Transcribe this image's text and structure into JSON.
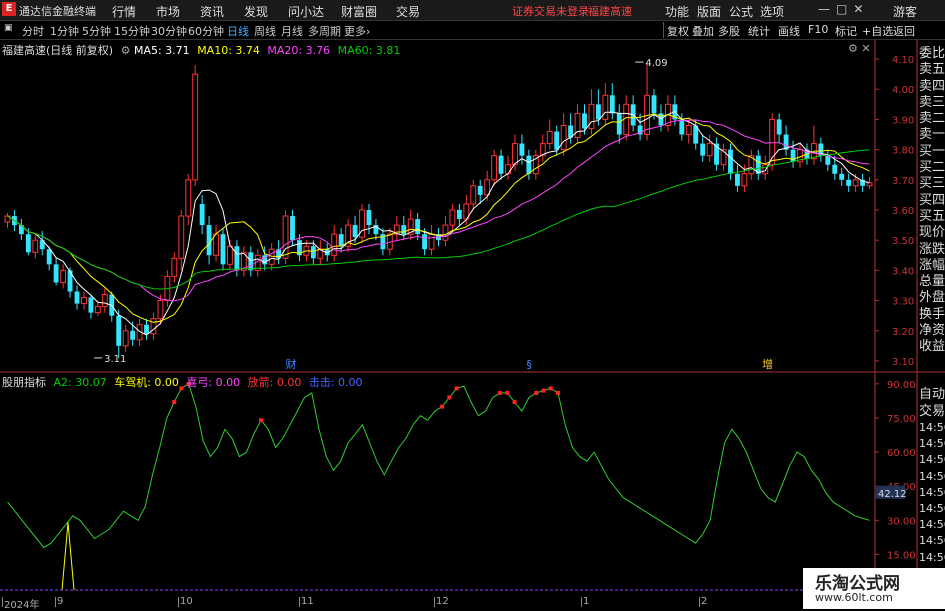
{
  "menubar": {
    "logo": "E",
    "app_title": "通达信金融终端",
    "menus": [
      "行情",
      "市场",
      "资讯",
      "发现",
      "问小达",
      "财富圈",
      "交易"
    ],
    "notice": "证券交易未登录",
    "stock_name": "福建高速",
    "right_menus": [
      "功能",
      "版面",
      "公式",
      "选项"
    ],
    "window_controls": "—□✕",
    "guest": "游客"
  },
  "toolbar": {
    "periods": [
      "分时",
      "1分钟",
      "5分钟",
      "15分钟",
      "30分钟",
      "60分钟",
      "日线",
      "周线",
      "月线",
      "多周期",
      "更多"
    ],
    "active": "日线",
    "right": [
      "复权",
      "叠加",
      "多股",
      "统计",
      "画线",
      "F10",
      "标记",
      "+自选",
      "返回"
    ]
  },
  "main_legend": {
    "title": "福建高速(日线 前复权)",
    "ma5": "MA5: 3.71",
    "ma10": "MA10: 3.74",
    "ma20": "MA20: 3.76",
    "ma60": "MA60: 3.81",
    "colors": {
      "ma5": "#ffffff",
      "ma10": "#ffff00",
      "ma20": "#ff44ff",
      "ma60": "#00cc00"
    }
  },
  "sub_legend": {
    "title": "股朋指标",
    "a2": "A2: 30.07",
    "a2_color": "#00cc00",
    "items": [
      {
        "label": "车驾机: 0.00",
        "color": "#ffff00"
      },
      {
        "label": "喜弓: 0.00",
        "color": "#ff44ff"
      },
      {
        "label": "放箭: 0.00",
        "color": "#ff3333"
      },
      {
        "label": "击击: 0.00",
        "color": "#3333ff"
      }
    ]
  },
  "chart_data": [
    {
      "type": "candlestick",
      "y_ticks": [
        "4.10",
        "4.00",
        "3.90",
        "3.80",
        "3.70",
        "3.60",
        "3.50",
        "3.40",
        "3.30",
        "3.20",
        "3.10"
      ],
      "ylim": [
        3.07,
        4.13
      ],
      "annotations": [
        {
          "text": "3.11",
          "x": 0.117,
          "y": 3.11
        },
        {
          "text": "4.09",
          "x": 0.737,
          "y": 4.09
        },
        {
          "text": "财",
          "x": 0.327,
          "y": 3.09
        },
        {
          "text": "§",
          "x": 0.603,
          "y": 3.09
        },
        {
          "text": "增",
          "x": 0.873,
          "y": 3.09
        }
      ],
      "candles": [
        [
          3.56,
          3.58,
          3.59,
          3.54
        ],
        [
          3.58,
          3.55,
          3.6,
          3.53
        ],
        [
          3.55,
          3.52,
          3.57,
          3.5
        ],
        [
          3.52,
          3.46,
          3.54,
          3.45
        ],
        [
          3.46,
          3.5,
          3.52,
          3.44
        ],
        [
          3.5,
          3.47,
          3.53,
          3.45
        ],
        [
          3.47,
          3.42,
          3.48,
          3.4
        ],
        [
          3.42,
          3.36,
          3.44,
          3.35
        ],
        [
          3.36,
          3.4,
          3.42,
          3.34
        ],
        [
          3.4,
          3.33,
          3.41,
          3.31
        ],
        [
          3.33,
          3.29,
          3.35,
          3.27
        ],
        [
          3.29,
          3.31,
          3.33,
          3.27
        ],
        [
          3.31,
          3.26,
          3.32,
          3.24
        ],
        [
          3.26,
          3.28,
          3.3,
          3.25
        ],
        [
          3.28,
          3.32,
          3.34,
          3.26
        ],
        [
          3.32,
          3.25,
          3.33,
          3.23
        ],
        [
          3.25,
          3.15,
          3.27,
          3.11
        ],
        [
          3.15,
          3.2,
          3.22,
          3.13
        ],
        [
          3.2,
          3.17,
          3.23,
          3.15
        ],
        [
          3.17,
          3.22,
          3.24,
          3.15
        ],
        [
          3.22,
          3.19,
          3.24,
          3.17
        ],
        [
          3.19,
          3.24,
          3.26,
          3.17
        ],
        [
          3.24,
          3.3,
          3.32,
          3.22
        ],
        [
          3.3,
          3.38,
          3.4,
          3.28
        ],
        [
          3.38,
          3.44,
          3.46,
          3.36
        ],
        [
          3.44,
          3.58,
          3.6,
          3.4
        ],
        [
          3.58,
          3.7,
          3.72,
          3.55
        ],
        [
          3.7,
          4.05,
          4.08,
          3.68
        ],
        [
          3.62,
          3.55,
          3.65,
          3.52
        ],
        [
          3.55,
          3.45,
          3.58,
          3.42
        ],
        [
          3.45,
          3.52,
          3.55,
          3.43
        ],
        [
          3.52,
          3.42,
          3.54,
          3.4
        ],
        [
          3.42,
          3.48,
          3.5,
          3.4
        ],
        [
          3.48,
          3.4,
          3.5,
          3.38
        ],
        [
          3.4,
          3.46,
          3.48,
          3.38
        ],
        [
          3.46,
          3.4,
          3.48,
          3.38
        ],
        [
          3.4,
          3.45,
          3.47,
          3.38
        ],
        [
          3.45,
          3.42,
          3.48,
          3.4
        ],
        [
          3.42,
          3.47,
          3.49,
          3.4
        ],
        [
          3.47,
          3.44,
          3.5,
          3.42
        ],
        [
          3.44,
          3.58,
          3.6,
          3.42
        ],
        [
          3.58,
          3.5,
          3.6,
          3.48
        ],
        [
          3.5,
          3.45,
          3.52,
          3.43
        ],
        [
          3.45,
          3.48,
          3.5,
          3.43
        ],
        [
          3.48,
          3.44,
          3.5,
          3.42
        ],
        [
          3.44,
          3.47,
          3.5,
          3.42
        ],
        [
          3.47,
          3.45,
          3.49,
          3.43
        ],
        [
          3.45,
          3.52,
          3.55,
          3.43
        ],
        [
          3.52,
          3.48,
          3.54,
          3.46
        ],
        [
          3.48,
          3.55,
          3.57,
          3.46
        ],
        [
          3.55,
          3.51,
          3.58,
          3.49
        ],
        [
          3.51,
          3.6,
          3.62,
          3.49
        ],
        [
          3.6,
          3.55,
          3.62,
          3.52
        ],
        [
          3.55,
          3.52,
          3.57,
          3.5
        ],
        [
          3.52,
          3.47,
          3.54,
          3.45
        ],
        [
          3.47,
          3.52,
          3.54,
          3.45
        ],
        [
          3.52,
          3.55,
          3.58,
          3.5
        ],
        [
          3.55,
          3.52,
          3.58,
          3.5
        ],
        [
          3.52,
          3.57,
          3.6,
          3.5
        ],
        [
          3.57,
          3.52,
          3.59,
          3.5
        ],
        [
          3.52,
          3.47,
          3.54,
          3.45
        ],
        [
          3.47,
          3.52,
          3.55,
          3.45
        ],
        [
          3.52,
          3.5,
          3.54,
          3.48
        ],
        [
          3.5,
          3.55,
          3.58,
          3.48
        ],
        [
          3.55,
          3.6,
          3.62,
          3.53
        ],
        [
          3.6,
          3.57,
          3.62,
          3.55
        ],
        [
          3.57,
          3.62,
          3.65,
          3.55
        ],
        [
          3.62,
          3.68,
          3.7,
          3.6
        ],
        [
          3.68,
          3.65,
          3.7,
          3.62
        ],
        [
          3.65,
          3.7,
          3.73,
          3.63
        ],
        [
          3.7,
          3.78,
          3.8,
          3.68
        ],
        [
          3.78,
          3.72,
          3.8,
          3.7
        ],
        [
          3.72,
          3.75,
          3.78,
          3.7
        ],
        [
          3.75,
          3.82,
          3.85,
          3.73
        ],
        [
          3.82,
          3.78,
          3.85,
          3.75
        ],
        [
          3.78,
          3.72,
          3.8,
          3.7
        ],
        [
          3.72,
          3.78,
          3.8,
          3.7
        ],
        [
          3.78,
          3.82,
          3.85,
          3.76
        ],
        [
          3.82,
          3.86,
          3.9,
          3.8
        ],
        [
          3.86,
          3.8,
          3.88,
          3.78
        ],
        [
          3.8,
          3.88,
          3.92,
          3.78
        ],
        [
          3.88,
          3.84,
          3.92,
          3.82
        ],
        [
          3.84,
          3.92,
          3.95,
          3.82
        ],
        [
          3.92,
          3.87,
          3.95,
          3.85
        ],
        [
          3.87,
          3.95,
          4.0,
          3.85
        ],
        [
          3.95,
          3.9,
          4.0,
          3.88
        ],
        [
          3.9,
          3.98,
          4.02,
          3.88
        ],
        [
          3.98,
          3.92,
          4.02,
          3.9
        ],
        [
          3.92,
          3.85,
          3.95,
          3.82
        ],
        [
          3.85,
          3.95,
          3.98,
          3.83
        ],
        [
          3.95,
          3.88,
          3.98,
          3.86
        ],
        [
          3.88,
          3.85,
          3.92,
          3.83
        ],
        [
          3.85,
          3.98,
          4.09,
          3.83
        ],
        [
          3.98,
          3.92,
          4.0,
          3.9
        ],
        [
          3.92,
          3.88,
          3.95,
          3.86
        ],
        [
          3.88,
          3.95,
          3.98,
          3.86
        ],
        [
          3.95,
          3.9,
          3.98,
          3.88
        ],
        [
          3.9,
          3.85,
          3.92,
          3.83
        ],
        [
          3.85,
          3.88,
          3.9,
          3.82
        ],
        [
          3.88,
          3.82,
          3.9,
          3.8
        ],
        [
          3.82,
          3.78,
          3.85,
          3.76
        ],
        [
          3.78,
          3.82,
          3.85,
          3.76
        ],
        [
          3.82,
          3.75,
          3.84,
          3.73
        ],
        [
          3.75,
          3.8,
          3.82,
          3.73
        ],
        [
          3.8,
          3.72,
          3.82,
          3.7
        ],
        [
          3.72,
          3.68,
          3.75,
          3.66
        ],
        [
          3.68,
          3.72,
          3.75,
          3.66
        ],
        [
          3.72,
          3.78,
          3.8,
          3.7
        ],
        [
          3.78,
          3.72,
          3.8,
          3.7
        ],
        [
          3.72,
          3.75,
          3.78,
          3.7
        ],
        [
          3.75,
          3.9,
          3.92,
          3.73
        ],
        [
          3.9,
          3.85,
          3.92,
          3.82
        ],
        [
          3.85,
          3.8,
          3.88,
          3.78
        ],
        [
          3.8,
          3.76,
          3.83,
          3.74
        ],
        [
          3.76,
          3.8,
          3.82,
          3.74
        ],
        [
          3.8,
          3.77,
          3.82,
          3.75
        ],
        [
          3.77,
          3.82,
          3.88,
          3.75
        ],
        [
          3.82,
          3.78,
          3.84,
          3.76
        ],
        [
          3.78,
          3.75,
          3.8,
          3.73
        ],
        [
          3.75,
          3.72,
          3.78,
          3.7
        ],
        [
          3.72,
          3.7,
          3.74,
          3.68
        ],
        [
          3.7,
          3.68,
          3.72,
          3.66
        ],
        [
          3.68,
          3.7,
          3.72,
          3.66
        ],
        [
          3.7,
          3.68,
          3.72,
          3.66
        ],
        [
          3.68,
          3.69,
          3.71,
          3.67
        ]
      ]
    },
    {
      "type": "line",
      "y_ticks": [
        "90.00",
        "75.00",
        "60.00",
        "45.00",
        "30.00",
        "15.00"
      ],
      "ylim": [
        13,
        93
      ],
      "current_value_tag": "42.12",
      "series": [
        {
          "name": "A2",
          "values": [
            38,
            34,
            30,
            26,
            22,
            18,
            20,
            24,
            28,
            32,
            30,
            26,
            22,
            24,
            26,
            30,
            34,
            32,
            30,
            36,
            50,
            62,
            75,
            82,
            88,
            90,
            80,
            65,
            58,
            62,
            70,
            66,
            58,
            60,
            68,
            74,
            70,
            62,
            66,
            72,
            78,
            84,
            86,
            70,
            58,
            52,
            56,
            64,
            68,
            72,
            64,
            56,
            50,
            56,
            62,
            66,
            72,
            76,
            74,
            78,
            80,
            84,
            88,
            89,
            82,
            76,
            78,
            84,
            86,
            86,
            82,
            78,
            84,
            86,
            87,
            88,
            86,
            72,
            62,
            58,
            56,
            60,
            54,
            48,
            44,
            40,
            38,
            36,
            34,
            32,
            30,
            28,
            26,
            24,
            22,
            20,
            24,
            30,
            48,
            64,
            70,
            66,
            60,
            52,
            44,
            40,
            38,
            46,
            54,
            60,
            58,
            52,
            48,
            42,
            38,
            36,
            34,
            32,
            31,
            30
          ]
        }
      ],
      "signal_points_indices": [
        23,
        24,
        25,
        35,
        60,
        61,
        62,
        68,
        69,
        70,
        73,
        74,
        75,
        76
      ]
    }
  ],
  "x_labels": [
    {
      "text": "2024年",
      "x": 4
    },
    {
      "text": "9",
      "x": 57
    },
    {
      "text": "10",
      "x": 180
    },
    {
      "text": "11",
      "x": 301
    },
    {
      "text": "12",
      "x": 436
    },
    {
      "text": "1",
      "x": 583
    },
    {
      "text": "2",
      "x": 701
    }
  ],
  "right_panel_top": [
    "委比",
    "卖五",
    "卖四",
    "卖三",
    "卖二",
    "卖一",
    "买一",
    "买二",
    "买三",
    "买四",
    "买五",
    "现价",
    "涨跌",
    "涨幅",
    "总量",
    "外盘",
    "换手",
    "净资",
    "收益"
  ],
  "right_panel_bottom": {
    "title1": "自动",
    "title2": "交易",
    "times": [
      "14:56",
      "14:56",
      "14:56",
      "14:56",
      "14:56",
      "14:56",
      "14:56",
      "14:56",
      "14:56"
    ]
  },
  "watermark": {
    "line1": "乐淘公式网",
    "line2": "www.60lt.com"
  }
}
